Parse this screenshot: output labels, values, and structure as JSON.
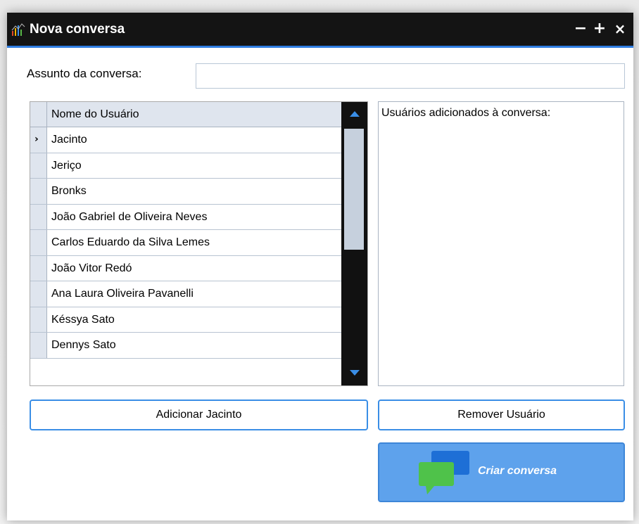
{
  "window": {
    "title": "Nova conversa",
    "controls": {
      "minimize": "−",
      "maximize": "+",
      "close": "×"
    }
  },
  "form": {
    "subject_label": "Assunto da conversa:",
    "subject_value": "",
    "subject_placeholder": ""
  },
  "user_grid": {
    "column_header": "Nome do Usuário",
    "selected_index": 0,
    "rows": [
      "Jacinto",
      "Jeriço",
      "Bronks",
      "João Gabriel de Oliveira Neves",
      "Carlos Eduardo da Silva Lemes",
      "João Vitor Redó",
      "Ana Laura Oliveira Pavanelli",
      "Késsya Sato",
      "Dennys Sato"
    ],
    "current_row_indicator": "›"
  },
  "added_users": {
    "label": "Usuários adicionados à conversa:",
    "items": []
  },
  "buttons": {
    "add": "Adicionar Jacinto",
    "remove": "Remover Usuário",
    "create": "Criar conversa"
  },
  "icons": {
    "app": "bar-chart-icon",
    "create": "chat-bubbles-icon"
  },
  "colors": {
    "titlebar": "#141414",
    "accent": "#3a8ee6",
    "create_button": "#5ea2ec",
    "header_bg": "#dfe5ee",
    "scrollbar": "#111111"
  }
}
